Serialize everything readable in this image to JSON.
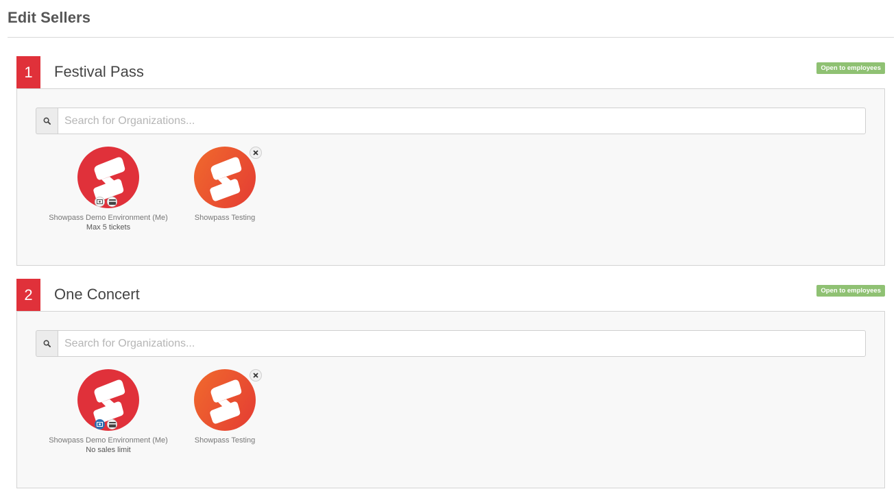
{
  "page": {
    "title": "Edit Sellers"
  },
  "sections": [
    {
      "number": "1",
      "title": "Festival Pass",
      "badge": "Open to employees",
      "search_placeholder": "Search for Organizations...",
      "sellers": [
        {
          "name": "Showpass Demo Environment (Me)",
          "limit": "Max 5 tickets",
          "cash_enabled": false
        },
        {
          "name": "Showpass Testing"
        }
      ]
    },
    {
      "number": "2",
      "title": "One Concert",
      "badge": "Open to employees",
      "search_placeholder": "Search for Organizations...",
      "sellers": [
        {
          "name": "Showpass Demo Environment (Me)",
          "limit": "No sales limit",
          "cash_enabled": true
        },
        {
          "name": "Showpass Testing"
        }
      ]
    }
  ],
  "icons": {
    "search": "search-icon",
    "remove": "close-icon",
    "cash": "cash-icon",
    "card": "credit-card-icon",
    "logo": "showpass-logo"
  },
  "colors": {
    "accent": "#e0313a",
    "badge": "#8fc173",
    "cash_active": "#2e6fb0"
  }
}
